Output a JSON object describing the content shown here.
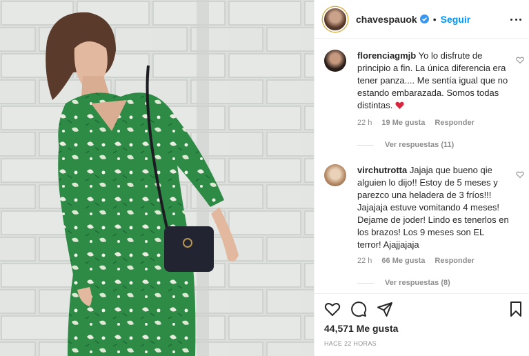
{
  "post": {
    "username": "chavespauok",
    "follow_label": "Seguir",
    "separator": "•",
    "likes": "44,571 Me gusta",
    "timestamp": "HACE 22 HORAS"
  },
  "comments": [
    {
      "username": "florenciagmjb",
      "text": " Yo lo disfrute de principio a fin. La única diferencia era tener panza.... Me sentía igual que no estando embarazada. Somos todas distintas.",
      "age": "22 h",
      "likes": "19 Me gusta",
      "reply": "Responder",
      "view_replies": "Ver respuestas (11)"
    },
    {
      "username": "virchutrotta",
      "text": " Jajaja que bueno qie alguien lo dijo!! Estoy de 5 meses y parezco una heladera de 3 fríos!!! Jajajaja estuve vomitando 4 meses! Dejame de joder! Lindo es tenerlos en los brazos! Los 9 meses son EL terror! Ajajjajaja",
      "age": "22 h",
      "likes": "66 Me gusta",
      "reply": "Responder",
      "view_replies": "Ver respuestas (8)"
    }
  ],
  "icons": {
    "verified": "verified-badge-icon",
    "more": "more-options-icon",
    "heart_emoji": "red-heart-emoji",
    "like": "heart-icon",
    "comment": "comment-icon",
    "share": "share-icon",
    "save": "bookmark-icon"
  },
  "colors": {
    "accent": "#0095f6",
    "muted": "#8e8e8e",
    "dress": "#2f8a45",
    "heart": "#d7263d"
  }
}
